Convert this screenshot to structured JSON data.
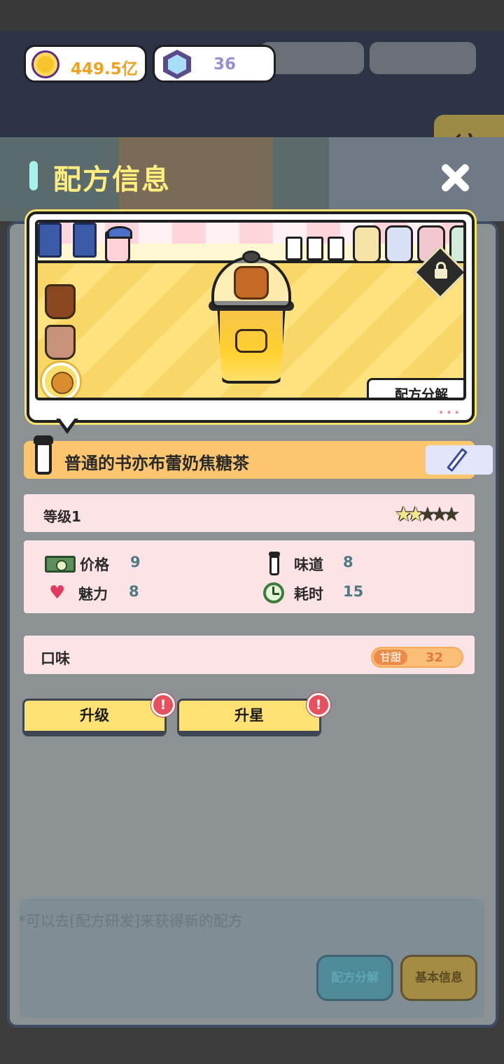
{
  "currency": {
    "gold": "449.5亿",
    "gems": "36",
    "gold_icon": "coin-icon",
    "gem_icon": "hexagon-gem-icon"
  },
  "panel": {
    "title": "配方信息",
    "close_icon": "close-icon"
  },
  "preview": {
    "decompose_label": "配方分解",
    "lock_icon": "lock-icon",
    "more_indicator": "•••"
  },
  "recipe": {
    "name": "普通的书亦布蕾奶焦糖茶",
    "edit_icon": "pencil-icon"
  },
  "level": {
    "label": "等级1",
    "stars_filled": 2,
    "stars_total": 5
  },
  "stats": {
    "price": {
      "label": "价格",
      "value": "9"
    },
    "taste": {
      "label": "味道",
      "value": "8"
    },
    "charm": {
      "label": "魅力",
      "value": "8"
    },
    "time": {
      "label": "耗时",
      "value": "15"
    }
  },
  "flavor": {
    "label": "口味",
    "tag": "甘甜",
    "value": "32"
  },
  "actions": {
    "upgrade": "升级",
    "star_up": "升星",
    "alert_mark": "!"
  },
  "colors": {
    "title": "#ffee7e",
    "name_bar": "#fcc66e",
    "info_bg": "#fce3e5",
    "stat_value": "#4f7a83",
    "button": "#fde172",
    "alert": "#e8505e"
  }
}
